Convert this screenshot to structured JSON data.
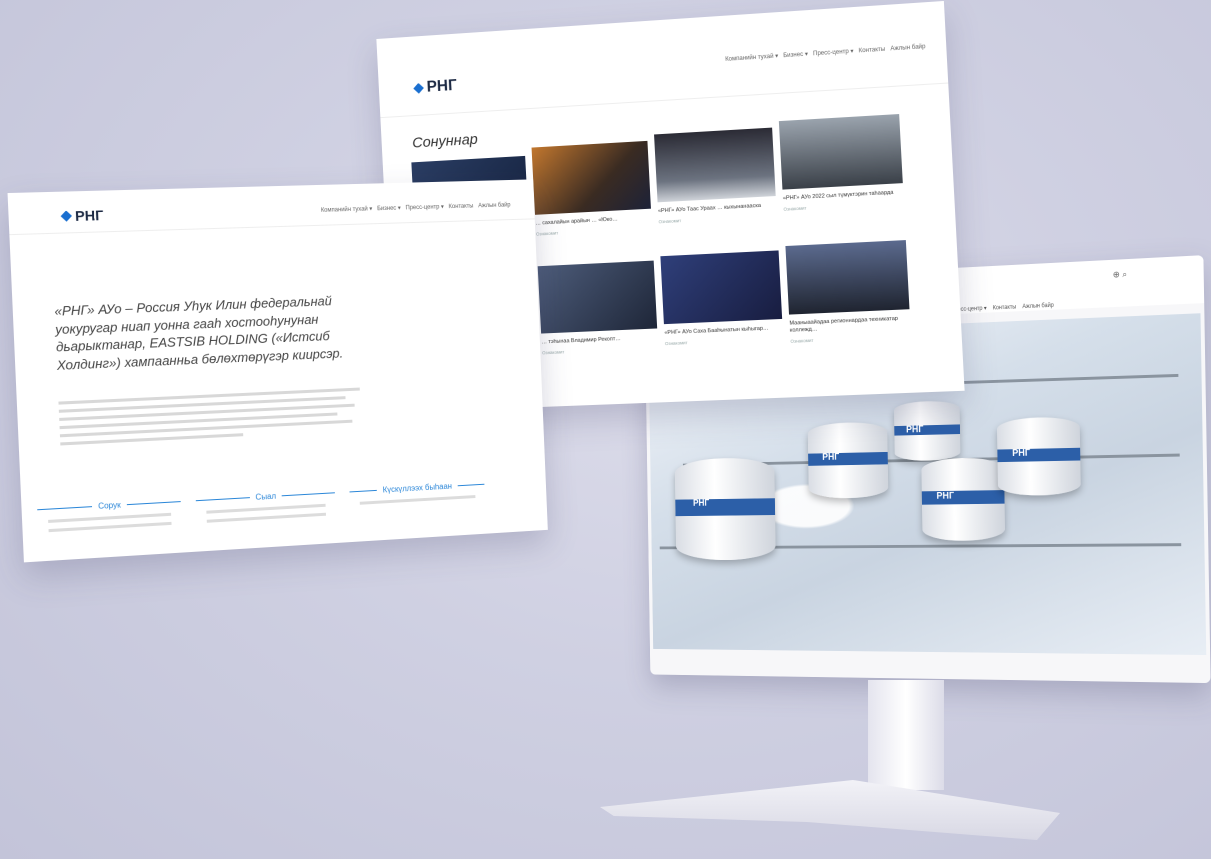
{
  "brand": {
    "logo_text": "РНГ"
  },
  "monitor": {
    "nav": [
      "Пресс-центр ▾",
      "Контакты",
      "Ажлын байр"
    ],
    "tools": "⊕ ⌕",
    "tank_label": "РНГ"
  },
  "news_page": {
    "nav": [
      "Компанийн тухай ▾",
      "Бизнес ▾",
      "Пресс-центр ▾",
      "Контакты",
      "Ажлын байр"
    ],
    "heading": "Сонуннар",
    "cards": [
      {
        "title": "",
        "meta": ""
      },
      {
        "title": "… сахалайын арайын … «Юко…",
        "meta": "Ознакомит"
      },
      {
        "title": "«РНГ» АУо Таас Ураах … кыхынанааска",
        "meta": "Ознакомит"
      },
      {
        "title": "«РНГ» АУо 2022 сыл түмүктэрин таһаарда",
        "meta": "Ознакомит"
      },
      {
        "title": "… тэһынаа Владимир Рекопт…",
        "meta": "Ознакомит"
      },
      {
        "title": "«РНГ» АУо Саха Бааһынатын кыһыгар…",
        "meta": "Ознакомит"
      },
      {
        "title": "Мааныаайадаа регионнардаа техникатар коллежд…",
        "meta": "Ознакомит"
      }
    ]
  },
  "about_page": {
    "nav": [
      "Компанийн тухай ▾",
      "Бизнес ▾",
      "Пресс-центр ▾",
      "Контакты",
      "Ажлын байр"
    ],
    "lead": "«РНГ» АУо – Россия Уһук Илин федеральнай уокуругар ниап уонна гааһ хостооһунунан дьарыктанар, EASTSIB HOLDING («Истсиб Холдинг») хампаанньа бөлөхтөрүгэр киирсэр.",
    "columns": [
      "Сорук",
      "Сыал",
      "Күскүллээх быһаан"
    ]
  }
}
